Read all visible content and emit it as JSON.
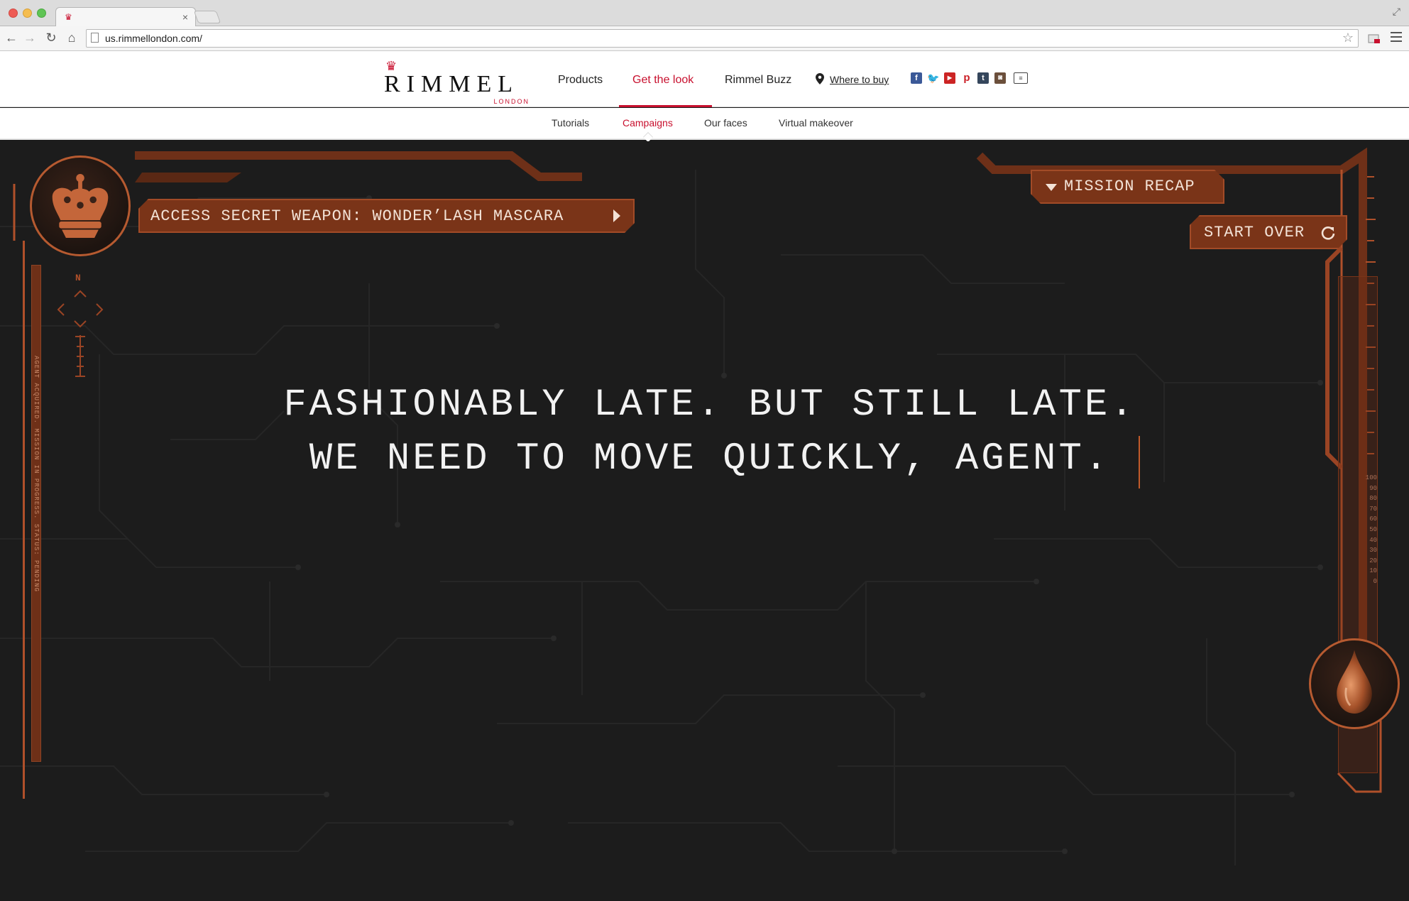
{
  "browser": {
    "tab_title": "",
    "tab_close": "×",
    "url": "us.rimmellondon.com/",
    "star": "☆"
  },
  "site": {
    "logo": {
      "brand": "RIMMEL",
      "sub": "LONDON"
    },
    "nav": [
      {
        "label": "Products"
      },
      {
        "label": "Get the look",
        "active": true
      },
      {
        "label": "Rimmel Buzz"
      }
    ],
    "where_to_buy": "Where to buy",
    "social_icons": [
      "facebook-icon",
      "twitter-icon",
      "youtube-icon",
      "pinterest-icon",
      "tumblr-icon",
      "instagram-icon",
      "news-icon"
    ],
    "subnav": [
      {
        "label": "Tutorials"
      },
      {
        "label": "Campaigns",
        "active": true
      },
      {
        "label": "Our faces"
      },
      {
        "label": "Virtual makeover"
      }
    ],
    "colors": {
      "brand_red": "#c8102e",
      "accent_copper": "#b0502a",
      "stage_bg": "#1c1c1c"
    }
  },
  "campaign": {
    "weapon_button": "ACCESS SECRET WEAPON: WONDER’LASH MASCARA",
    "mission_recap": "MISSION RECAP",
    "start_over": "START OVER",
    "compass_north": "N",
    "rail_text": "AGENT ACQUIRED. MISSION IN PROGRESS. STATUS: PENDING",
    "headline": {
      "line1": "FASHIONABLY LATE. BUT STILL LATE.",
      "line2": "WE NEED TO MOVE QUICKLY, AGENT."
    },
    "scale": [
      "100",
      "90",
      "80",
      "70",
      "60",
      "50",
      "40",
      "30",
      "20",
      "10",
      "0"
    ]
  }
}
